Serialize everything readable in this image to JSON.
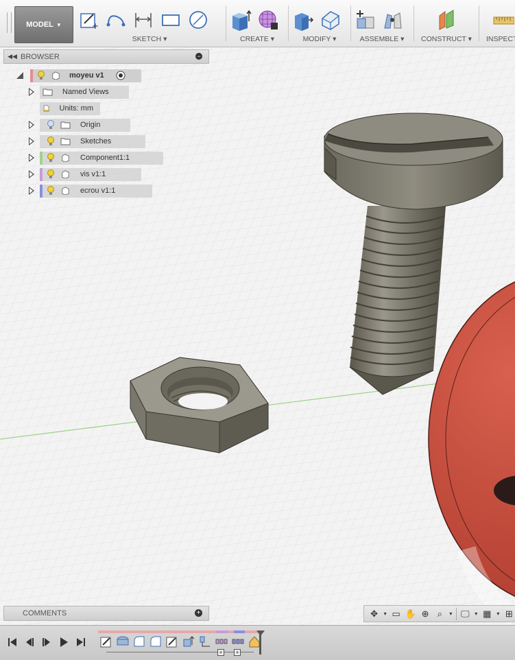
{
  "toolbar": {
    "workspace": "MODEL",
    "groups": {
      "sketch": "SKETCH",
      "create": "CREATE",
      "modify": "MODIFY",
      "assemble": "ASSEMBLE",
      "construct": "CONSTRUCT",
      "inspect": "INSPECT"
    }
  },
  "browser": {
    "title": "BROWSER",
    "root": "moyeu v1",
    "items": [
      {
        "label": "Named Views",
        "icon": "folder-icon"
      },
      {
        "label": "Units: mm",
        "icon": "document-icon"
      },
      {
        "label": "Origin",
        "icon": "folder-icon"
      },
      {
        "label": "Sketches",
        "icon": "folder-icon"
      },
      {
        "label": "Component1:1",
        "icon": "component-icon",
        "color": "#9fd48a"
      },
      {
        "label": "vis v1:1",
        "icon": "component-icon",
        "color": "#c99adc"
      },
      {
        "label": "ecrou v1:1",
        "icon": "component-icon",
        "color": "#8a8ee0"
      }
    ]
  },
  "comments": {
    "title": "COMMENTS"
  },
  "colors": {
    "toolbar_bg": "#e9e9e9",
    "viewport_bg": "#f3f3f3",
    "grid": "#dcdcdc",
    "metal": "#7e7b72",
    "disc_red": "#c84a3a",
    "timeline_sketch_bar": "#e8a8a8"
  }
}
